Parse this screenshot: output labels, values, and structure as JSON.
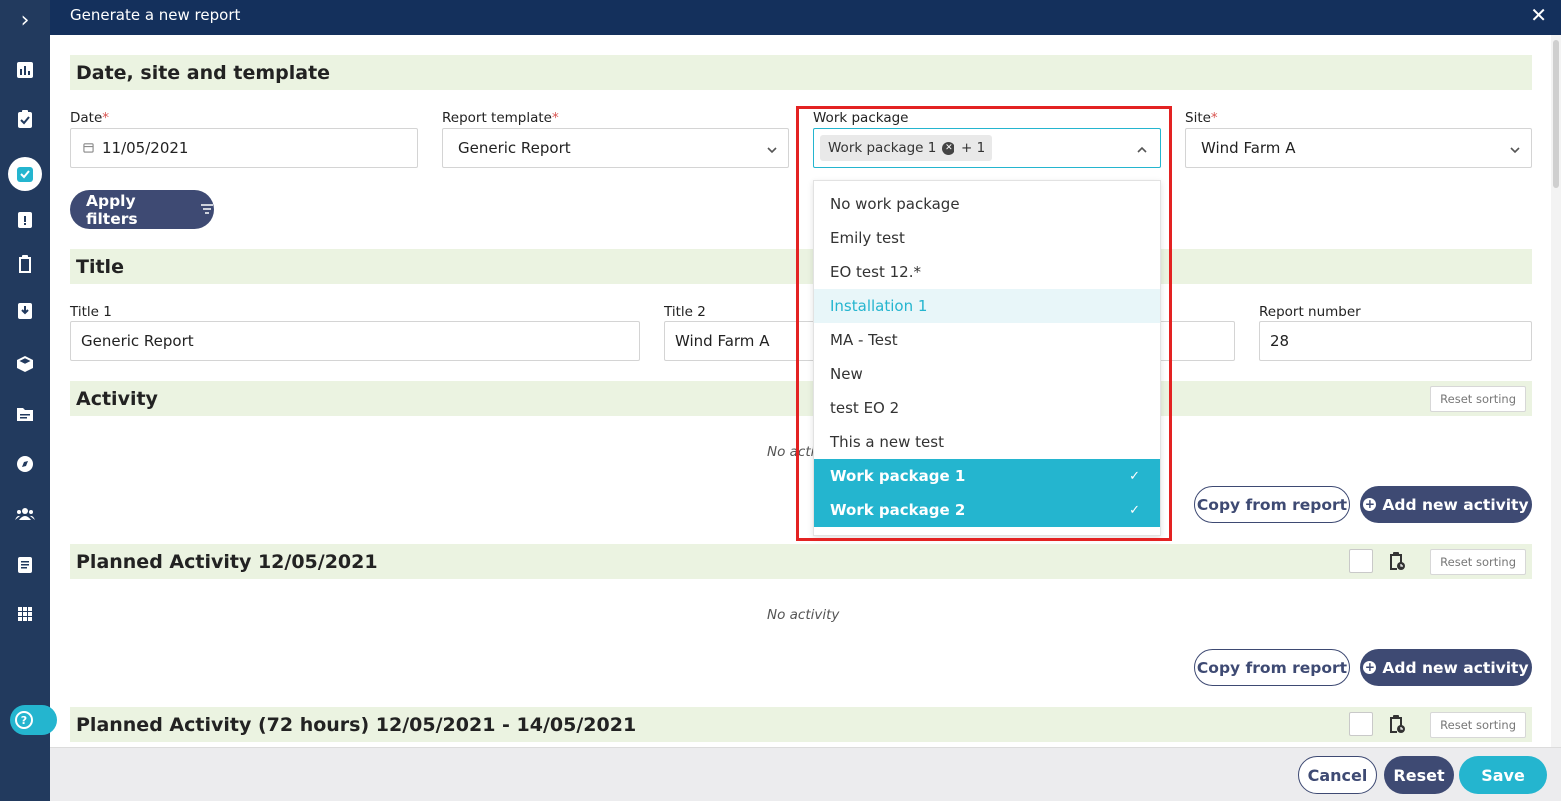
{
  "header": {
    "title": "Generate a new report",
    "close_icon": "✕"
  },
  "sidebar": {
    "expand_icon": "›",
    "items": [
      "chart-icon",
      "checklist-icon",
      "check-active-icon",
      "alert-clipboard-icon",
      "clipboard-icon",
      "download-clipboard-icon",
      "box-icon",
      "folder-icon",
      "compass-icon",
      "people-icon",
      "calendar-doc-icon",
      "apps-grid-icon"
    ],
    "help_label": "?"
  },
  "sections": {
    "date_site": "Date, site and template",
    "title": "Title",
    "activity": "Activity",
    "planned": "Planned Activity 12/05/2021",
    "planned72": "Planned Activity (72 hours) 12/05/2021 - 14/05/2021"
  },
  "form": {
    "date_label": "Date",
    "date_value": "11/05/2021",
    "template_label": "Report template",
    "template_value": "Generic Report",
    "wp_label": "Work package",
    "wp_tag": "Work package 1",
    "wp_more": "+ 1",
    "site_label": "Site",
    "site_value": "Wind Farm A",
    "required_mark": "*",
    "apply_filters": "Apply filters",
    "title1_label": "Title 1",
    "title1_value": "Generic Report",
    "title2_label": "Title 2",
    "title2_value": "Wind Farm A",
    "report_number_label": "Report number",
    "report_number_value": "28"
  },
  "dropdown": {
    "items": [
      {
        "label": "No work package",
        "state": "normal"
      },
      {
        "label": "Emily test",
        "state": "normal"
      },
      {
        "label": "EO test 12.*",
        "state": "normal"
      },
      {
        "label": "Installation 1",
        "state": "hover"
      },
      {
        "label": "MA - Test",
        "state": "normal"
      },
      {
        "label": "New",
        "state": "normal"
      },
      {
        "label": "test EO 2",
        "state": "normal"
      },
      {
        "label": "This a new test",
        "state": "normal"
      },
      {
        "label": "Work package 1",
        "state": "selected"
      },
      {
        "label": "Work package 2",
        "state": "selected"
      }
    ],
    "check_mark": "✓"
  },
  "activity": {
    "reset_sorting": "Reset sorting",
    "no_activity_partial": "No acti",
    "no_activity": "No activity",
    "copy_from_report": "Copy from report",
    "add_new_activity": "Add new activity"
  },
  "footer": {
    "cancel": "Cancel",
    "reset": "Reset",
    "save": "Save"
  },
  "colors": {
    "navy": "#14305c",
    "sidebar": "#223a5e",
    "accent": "#24b5cf",
    "button_dark": "#3e4a73",
    "section_bg": "#ebf3e1",
    "highlight_border": "#e32222"
  }
}
